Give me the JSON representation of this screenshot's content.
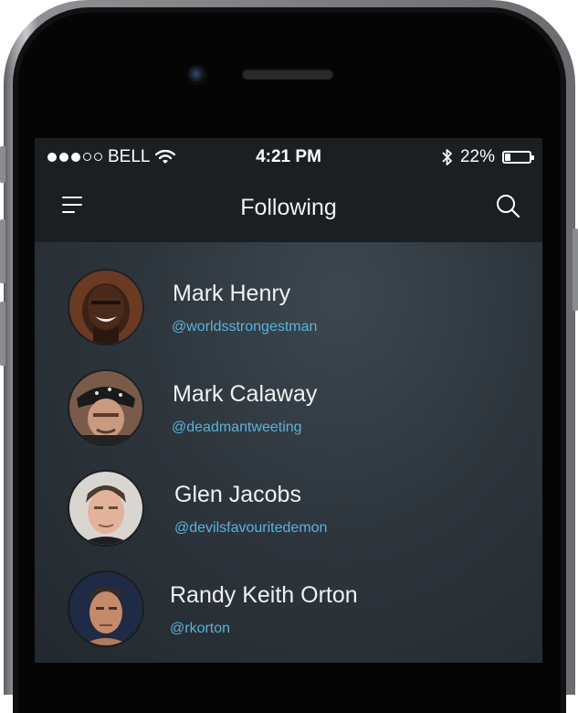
{
  "status_bar": {
    "carrier": "BELL",
    "time": "4:21 PM",
    "battery": "22%",
    "battery_level": 0.22,
    "signal_bars_filled": 3,
    "signal_bars_total": 5
  },
  "navbar": {
    "title": "Following",
    "left_icon": "hamburger-menu-icon",
    "right_icon": "search-icon"
  },
  "following": [
    {
      "name": "Mark Henry",
      "handle": "@worldsstrongestman"
    },
    {
      "name": "Mark Calaway",
      "handle": "@deadmantweeting"
    },
    {
      "name": "Glen Jacobs",
      "handle": "@devilsfavouritedemon"
    },
    {
      "name": "Randy Keith Orton",
      "handle": "@rkorton"
    }
  ],
  "colors": {
    "handle": "#5ab2dc",
    "header_bg": "#1c1f22",
    "screen_bg": "#2e363d"
  }
}
